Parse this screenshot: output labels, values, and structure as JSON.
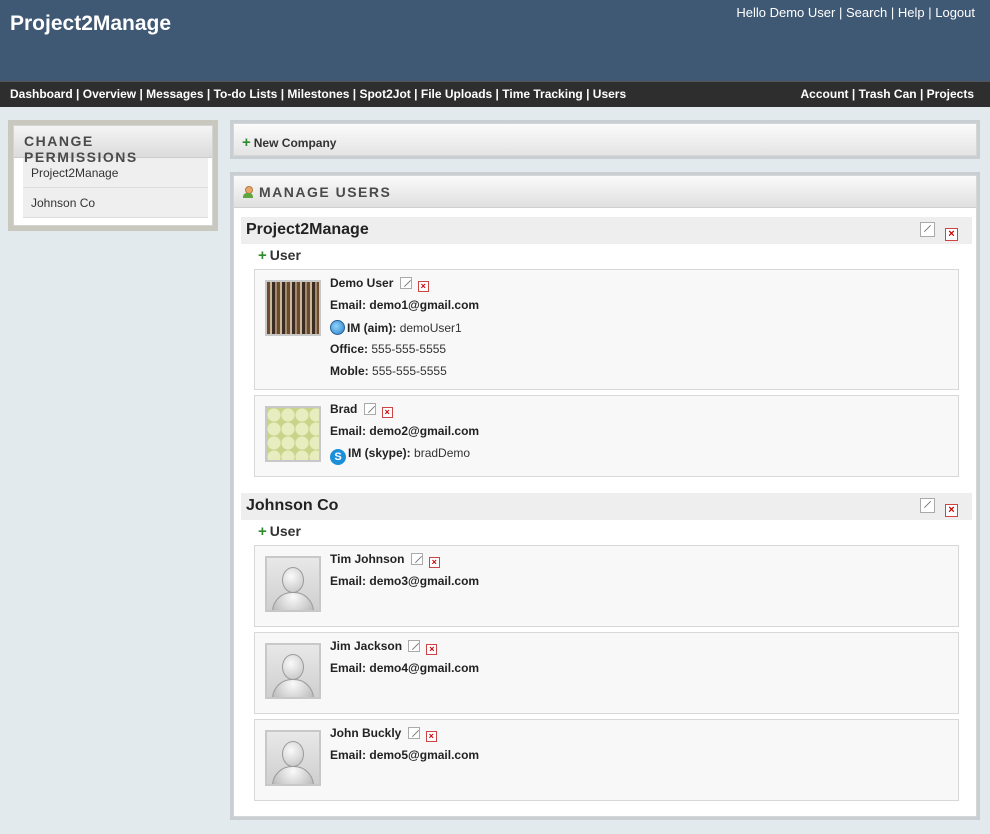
{
  "header": {
    "logo": "Project2Manage",
    "top_links": [
      "Hello Demo User",
      "Search",
      "Help",
      "Logout"
    ]
  },
  "nav": {
    "left": [
      "Dashboard",
      "Overview",
      "Messages",
      "To-do Lists",
      "Milestones",
      "Spot2Jot",
      "File Uploads",
      "Time Tracking",
      "Users"
    ],
    "right": [
      "Account",
      "Trash Can",
      "Projects"
    ]
  },
  "sidebar": {
    "title": "CHANGE PERMISSIONS",
    "items": [
      "Project2Manage",
      "Johnson Co"
    ]
  },
  "new_company": {
    "label": "New Company"
  },
  "manage_users": {
    "title": "MANAGE USERS"
  },
  "labels": {
    "add_user": "User",
    "email": "Email:",
    "office": "Office:",
    "mobile": "Moble:"
  },
  "companies": [
    {
      "name": "Project2Manage",
      "users": [
        {
          "name": "Demo User",
          "email": "demo1@gmail.com",
          "im_label": "IM (aim):",
          "im_value": "demoUser1",
          "office": "555-555-5555",
          "mobile": "555-555-5555"
        },
        {
          "name": "Brad",
          "email": "demo2@gmail.com",
          "im_label": "IM (skype):",
          "im_value": "bradDemo"
        }
      ]
    },
    {
      "name": "Johnson Co",
      "users": [
        {
          "name": "Tim Johnson",
          "email": "demo3@gmail.com"
        },
        {
          "name": "Jim Jackson",
          "email": "demo4@gmail.com"
        },
        {
          "name": "John Buckly",
          "email": "demo5@gmail.com"
        }
      ]
    }
  ],
  "icons": {
    "add": "plus-icon",
    "edit": "edit-icon",
    "delete": "delete-icon",
    "aim": "aim-icon",
    "skype": "skype-icon",
    "manage_users": "user-icon"
  }
}
